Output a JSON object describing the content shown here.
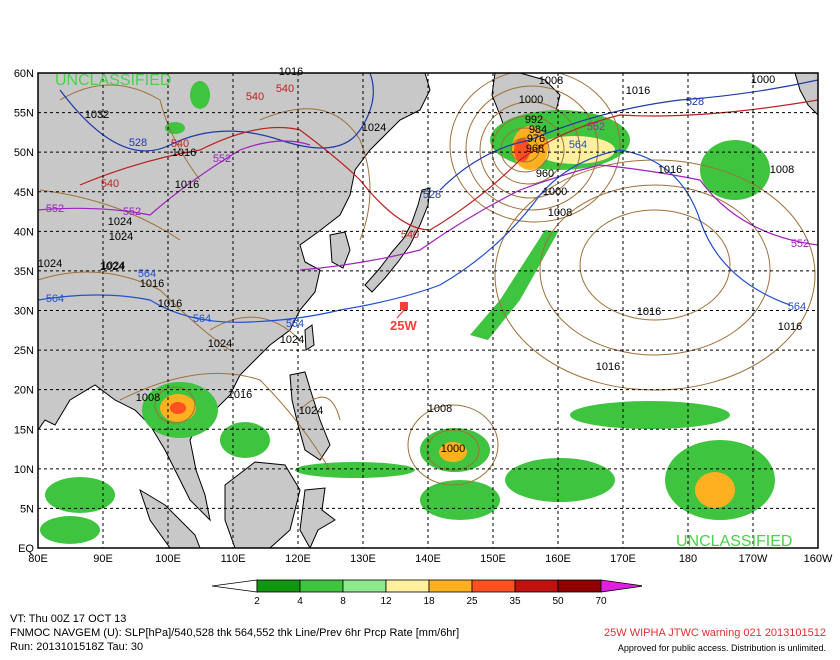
{
  "map": {
    "classification_top": "UNCLASSIFIED",
    "classification_bottom": "UNCLASSIFIED",
    "storm_label": "25W",
    "colors": {
      "land": "#c8c8c8",
      "sea": "#ffffff",
      "slp_contour": "#a0703a",
      "thk_528": "#1e3aa8",
      "thk_540": "#c02020",
      "thk_552": "#a020c0",
      "thk_564": "#2050d0",
      "storm": "#ff3b3b",
      "classification": "#4cd04c"
    },
    "lat_labels": [
      "60N",
      "55N",
      "50N",
      "45N",
      "40N",
      "35N",
      "30N",
      "25N",
      "20N",
      "15N",
      "10N",
      "5N",
      "EQ"
    ],
    "lon_labels": [
      "80E",
      "90E",
      "100E",
      "110E",
      "120E",
      "130E",
      "140E",
      "150E",
      "160E",
      "170E",
      "180",
      "170W",
      "160W"
    ],
    "isobar_labels": [
      "1008",
      "1000",
      "1016",
      "1024",
      "1024",
      "1016",
      "1016",
      "1024",
      "1016",
      "1024",
      "1024",
      "1024",
      "1016",
      "1016",
      "1024",
      "1024",
      "1016",
      "1008",
      "1000",
      "1008",
      "1016",
      "1024",
      "1016",
      "1016",
      "1008",
      "1000",
      "1016",
      "1008",
      "1000",
      "992",
      "984",
      "976",
      "968",
      "960",
      "1032"
    ],
    "thickness_labels": [
      "540",
      "540",
      "540",
      "540",
      "540",
      "552",
      "552",
      "552",
      "552",
      "552",
      "528",
      "528",
      "528",
      "564",
      "564",
      "564",
      "564",
      "564",
      "564"
    ]
  },
  "scale": {
    "values": [
      "2",
      "4",
      "8",
      "12",
      "18",
      "25",
      "35",
      "50",
      "70"
    ],
    "colors": [
      "#119611",
      "#3ec43e",
      "#8ee88e",
      "#fff0a0",
      "#ffb020",
      "#ff5020",
      "#c01010",
      "#900000",
      "#e020e0"
    ]
  },
  "footer": {
    "vt": "VT: Thu 00Z 17 OCT 13",
    "model": "FNMOC NAVGEM (U): SLP[hPa]/540,528 thk 564,552 thk Line/Prev 6hr Prcp Rate [mm/6hr]",
    "run": "Run: 2013101518Z Tau: 30",
    "warning": "25W WIPHA JTWC warning 021 2013101512",
    "approved": "Approved for public access. Distribution is unlimited."
  }
}
